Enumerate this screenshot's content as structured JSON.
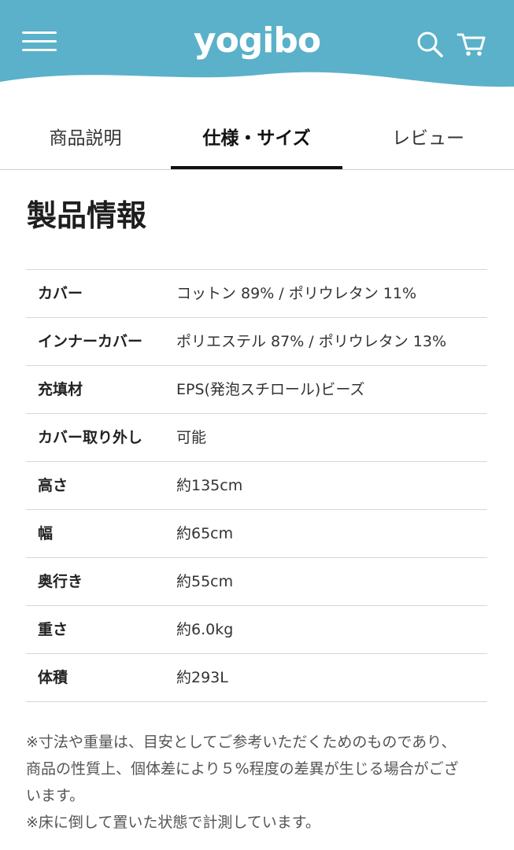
{
  "header": {
    "brand": "yogibo",
    "bg_color": "#5ab1c9",
    "menu_icon": "hamburger-menu-icon",
    "search_icon": "search-icon",
    "cart_icon": "cart-icon"
  },
  "tabs": [
    {
      "label": "商品説明",
      "active": false
    },
    {
      "label": "仕様・サイズ",
      "active": true
    },
    {
      "label": "レビュー",
      "active": false
    }
  ],
  "section": {
    "title": "製品情報"
  },
  "specs": [
    {
      "label": "カバー",
      "value": "コットン 89% / ポリウレタン 11%"
    },
    {
      "label": "インナーカバー",
      "value": "ポリエステル 87% / ポリウレタン 13%"
    },
    {
      "label": "充填材",
      "value": "EPS(発泡スチロール)ビーズ"
    },
    {
      "label": "カバー取り外し",
      "value": "可能"
    },
    {
      "label": "高さ",
      "value": "約135cm"
    },
    {
      "label": "幅",
      "value": "約65cm"
    },
    {
      "label": "奥行き",
      "value": "約55cm"
    },
    {
      "label": "重さ",
      "value": "約6.0kg"
    },
    {
      "label": "体積",
      "value": "約293L"
    }
  ],
  "notes": [
    "※寸法や重量は、目安としてご参考いただくためのものであり、",
    "商品の性質上、個体差により５%程度の差異が生じる場合がござ",
    "います。",
    "※床に倒して置いた状態で計測しています。"
  ]
}
